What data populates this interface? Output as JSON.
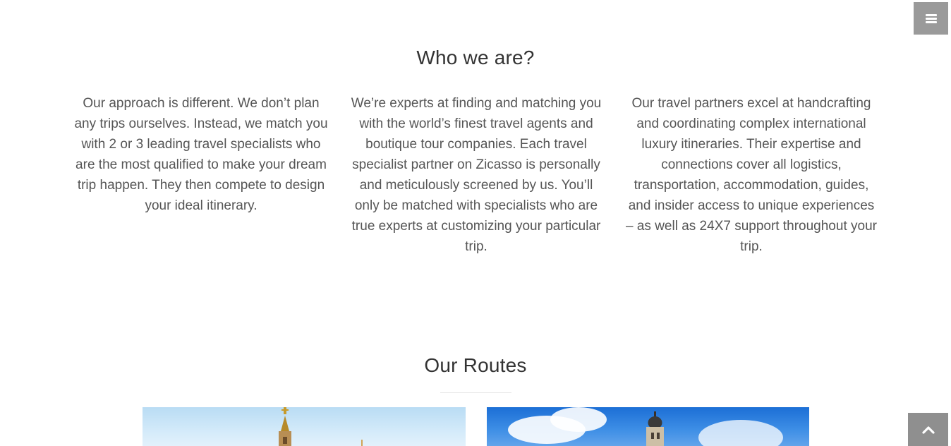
{
  "header": {
    "menu_icon": "hamburger-menu-icon"
  },
  "about": {
    "title": "Who we are?",
    "columns": [
      {
        "text": "Our approach is different. We don’t plan any trips ourselves. Instead, we match you with 2 or 3 leading travel specialists who are the most qualified to make your dream trip happen. They then compete to design your ideal itinerary."
      },
      {
        "text": "We’re experts at finding and matching you with the world’s finest travel agents and boutique tour companies. Each travel specialist partner on Zicasso is personally and meticulously screened by us. You’ll only be matched with specialists who are true experts at customizing your particular trip."
      },
      {
        "text": "Our travel partners excel at handcrafting and coordinating complex international luxury itineraries. Their expertise and connections cover all logistics, transportation, accommodation, guides, and insider access to unique experiences – as well as 24X7 support throughout your trip."
      }
    ]
  },
  "routes": {
    "title": "Our Routes",
    "cards": [
      {
        "image": "church-tower-light-sky-photo"
      },
      {
        "image": "church-tower-blue-sky-photo"
      }
    ]
  },
  "footer": {
    "back_to_top_icon": "chevron-up-icon"
  },
  "colors": {
    "menu_button_bg": "#9a9a9a",
    "back_to_top_bg": "#8f8f8f",
    "heading": "#333333",
    "body_text": "#555555"
  }
}
